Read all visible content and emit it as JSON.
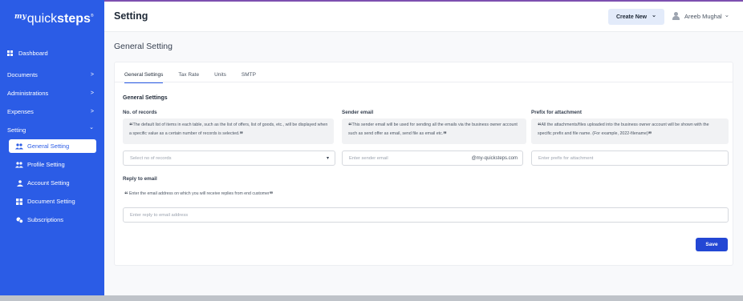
{
  "app": {
    "logo_my": "my",
    "logo_quick": "quick",
    "logo_steps": "steps",
    "logo_reg": "®"
  },
  "sidebar": {
    "dashboard": "Dashboard",
    "documents": "Documents",
    "administrations": "Administrations",
    "expenses": "Expenses",
    "setting": "Setting",
    "sub_items": [
      {
        "label": "General Setting",
        "icon": "users-icon",
        "active": true
      },
      {
        "label": "Profile Setting",
        "icon": "users-icon",
        "active": false
      },
      {
        "label": "Account Setting",
        "icon": "account-icon",
        "active": false
      },
      {
        "label": "Document Setting",
        "icon": "grid-icon",
        "active": false
      },
      {
        "label": "Subscriptions",
        "icon": "subscription-icon",
        "active": false
      }
    ],
    "chevron_right": ">",
    "chevron_down": "⌄"
  },
  "header": {
    "title": "Setting",
    "create_new": "Create New",
    "create_new_caret": "⌄",
    "user_name": "Areeb Mughal",
    "user_caret": "⌄"
  },
  "main": {
    "heading": "General Setting",
    "tabs": [
      "General Settings",
      "Tax Rate",
      "Units",
      "SMTP"
    ],
    "section_title": "General Settings",
    "no_records": {
      "label": "No. of records",
      "help": "The default list of items in each table, such as the list of offers, list of goods, etc., will be displayed when a specific value as a certain number of records is selected.",
      "placeholder": "Select no of records",
      "caret": "▾"
    },
    "sender_email": {
      "label": "Sender email",
      "help": "This sender email will be used for sending all the emails via the business owner account such as send offer as email, send file as email etc.",
      "placeholder": "Enter sender email",
      "suffix": "@my-quicksteps.com"
    },
    "prefix": {
      "label": "Prefix for attachment",
      "help": "All the attachments/files uploaded into the business owner account will be shown with the specific prefix and file name. (For example, 2022-filename)",
      "placeholder": "Enter prefix for attachment"
    },
    "reply_email": {
      "label": "Reply to email",
      "help": "Enter the email address on which you will receive replies from end customer",
      "placeholder": "Enter reply to email address"
    },
    "open_quote": "“",
    "close_quote": "”",
    "save": "Save"
  },
  "colors": {
    "sidebar_bg": "#2b5ce6",
    "accent": "#2347d4",
    "create_btn_bg": "#e3ebfa"
  }
}
